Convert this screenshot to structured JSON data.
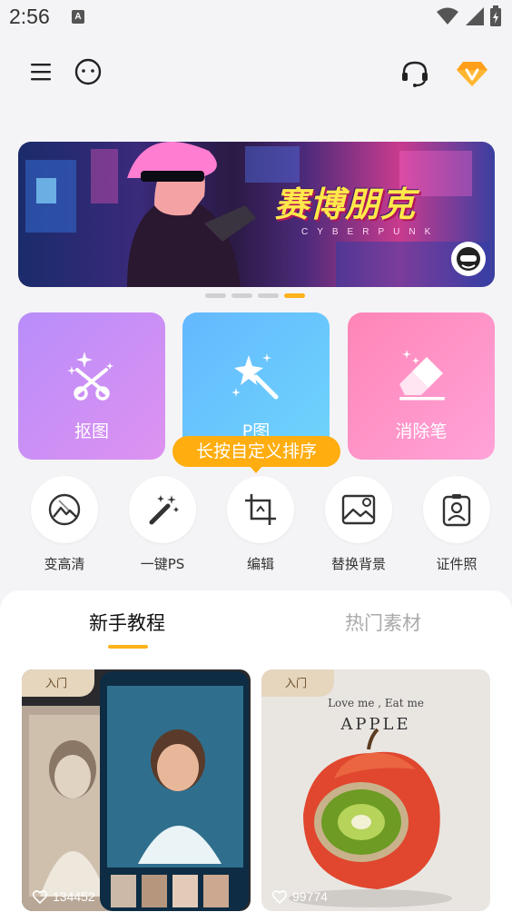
{
  "status_bar": {
    "time": "2:56",
    "notif_letter": "A"
  },
  "banner": {
    "title": "赛博朋克",
    "subtitle": "CYBERPUNK",
    "dots_count": 4,
    "active_dot": 3
  },
  "main_tiles": [
    {
      "label": "抠图",
      "icon": "scissors-sparkle-icon",
      "gradient": [
        "#b88dfb",
        "#de92f0"
      ]
    },
    {
      "label": "P图",
      "icon": "magic-wand-icon",
      "gradient": [
        "#63b8ff",
        "#6fd5fb"
      ]
    },
    {
      "label": "消除笔",
      "icon": "eraser-icon",
      "gradient": [
        "#ff85b6",
        "#ffa3d9"
      ]
    }
  ],
  "tooltip": {
    "text": "长按自定义排序"
  },
  "tools": [
    {
      "label": "变高清",
      "icon": "enhance-icon"
    },
    {
      "label": "一键PS",
      "icon": "magic-wand-icon"
    },
    {
      "label": "编辑",
      "icon": "crop-icon"
    },
    {
      "label": "替换背景",
      "icon": "replace-background-icon"
    },
    {
      "label": "证件照",
      "icon": "id-photo-icon"
    }
  ],
  "tabs": [
    {
      "label": "新手教程",
      "active": true
    },
    {
      "label": "热门素材",
      "active": false
    }
  ],
  "cards": [
    {
      "badge": "入门",
      "likes": "134452"
    },
    {
      "badge": "入门",
      "likes": "99774",
      "line1": "Love me , Eat me",
      "line2": "APPLE"
    }
  ],
  "colors": {
    "accent": "#ffb21a",
    "tooltip": "#ffad0f"
  }
}
